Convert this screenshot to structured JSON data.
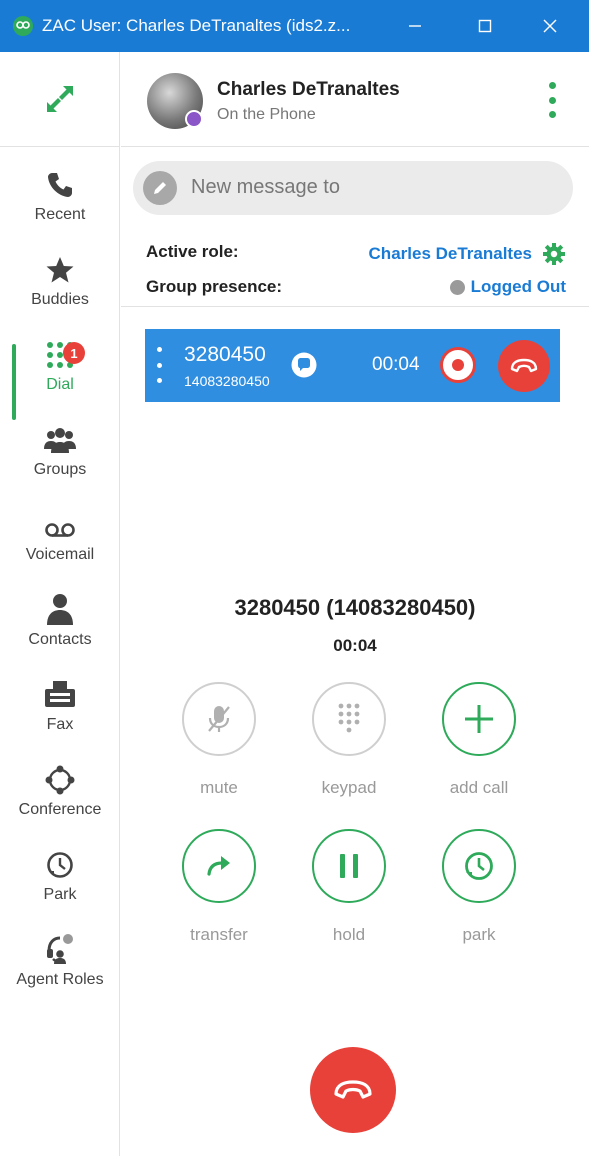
{
  "window": {
    "title": "ZAC User: Charles DeTranaltes (ids2.z...",
    "minimize_label": "—",
    "maximize_label": "☐",
    "close_label": "✕"
  },
  "user": {
    "name": "Charles DeTranaltes",
    "status": "On the Phone"
  },
  "message": {
    "placeholder": "New message to"
  },
  "roles": {
    "active_role_label": "Active role:",
    "active_role_value": "Charles DeTranaltes",
    "group_presence_label": "Group presence:",
    "group_presence_value": "Logged Out"
  },
  "sidebar": {
    "items": [
      {
        "label": "Recent",
        "icon": "phone-icon"
      },
      {
        "label": "Buddies",
        "icon": "star-icon"
      },
      {
        "label": "Dial",
        "icon": "dialpad-icon",
        "badge": "1",
        "active": true
      },
      {
        "label": "Groups",
        "icon": "group-icon"
      },
      {
        "label": "Voicemail",
        "icon": "voicemail-icon"
      },
      {
        "label": "Contacts",
        "icon": "person-icon"
      },
      {
        "label": "Fax",
        "icon": "fax-icon"
      },
      {
        "label": "Conference",
        "icon": "conference-icon"
      },
      {
        "label": "Park",
        "icon": "park-icon"
      },
      {
        "label": "Agent Roles",
        "icon": "agent-icon"
      }
    ]
  },
  "call_card": {
    "number": "3280450",
    "subnumber": "14083280450",
    "duration": "00:04"
  },
  "call_detail": {
    "title": "3280450 (14083280450)",
    "duration": "00:04"
  },
  "controls": {
    "mute": "mute",
    "keypad": "keypad",
    "add_call": "add call",
    "transfer": "transfer",
    "hold": "hold",
    "park": "park"
  },
  "colors": {
    "accent_green": "#2eaa5a",
    "brand_blue": "#1a7bd4",
    "hangup_red": "#e8413a",
    "card_blue": "#2f8ee0"
  }
}
